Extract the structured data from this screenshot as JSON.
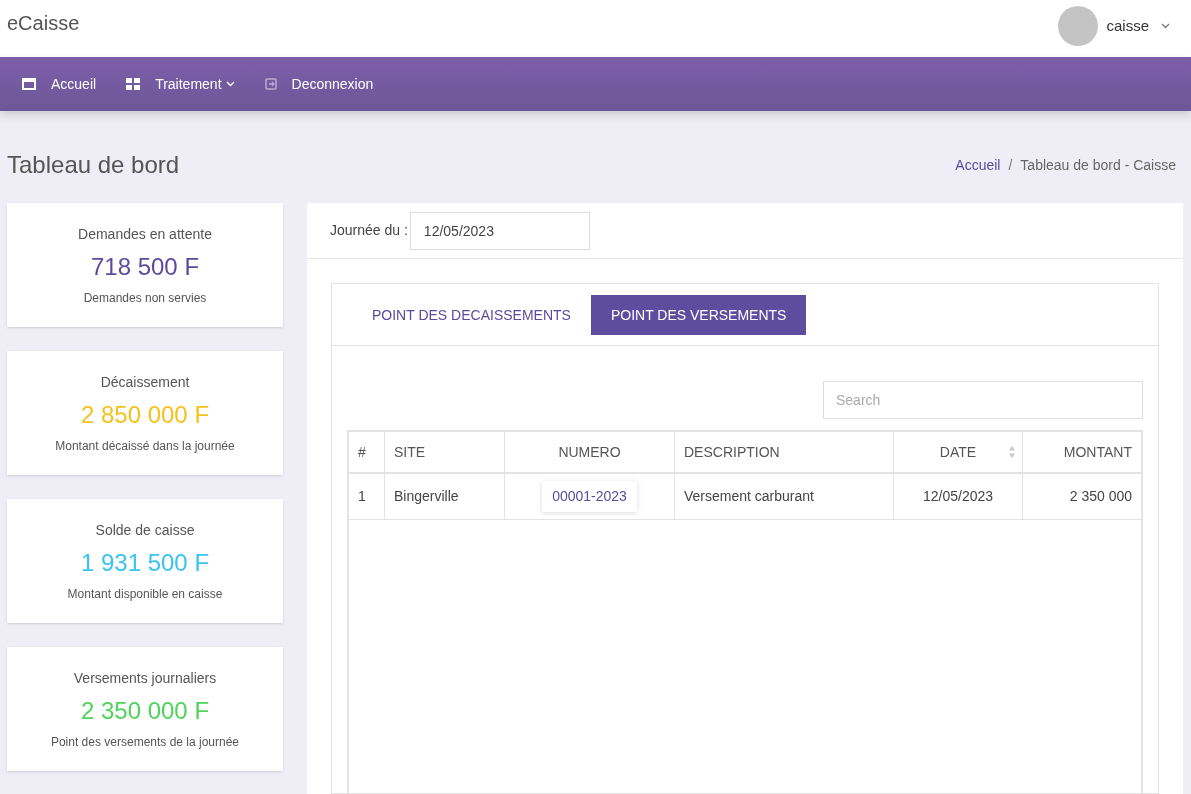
{
  "app_title": "eCaisse",
  "user": {
    "name": "caisse"
  },
  "nav": [
    {
      "label": "Accueil",
      "kind": "window"
    },
    {
      "label": "Traitement",
      "kind": "grid",
      "dropdown": true
    },
    {
      "label": "Deconnexion",
      "kind": "exit",
      "dropdown": false
    }
  ],
  "page_title": "Tableau de bord",
  "breadcrumb": [
    {
      "label": "Accueil",
      "kind": "link"
    },
    {
      "label": "/",
      "kind": "separator"
    },
    {
      "label": "Tableau de bord - Caisse",
      "kind": "current"
    }
  ],
  "stats": [
    {
      "title": "Demandes en attente",
      "value": "718 500 F",
      "caption": "Demandes non servies",
      "color": "#5b4a9e"
    },
    {
      "title": "Décaissement",
      "value": "2 850 000 F",
      "caption": "Montant décaissé dans la journée",
      "color": "#f5c21b"
    },
    {
      "title": "Solde de caisse",
      "value": "1 931 500 F",
      "caption": "Montant disponible en caisse",
      "color": "#38c3f0"
    },
    {
      "title": "Versements journaliers",
      "value": "2 350 000 F",
      "caption": "Point des versements de la journée",
      "color": "#4fd35a"
    }
  ],
  "date_filter": {
    "label": "Journée du :",
    "value": "12/05/2023"
  },
  "tabs": [
    {
      "label": "POINT DES DECAISSEMENTS",
      "selected": false
    },
    {
      "label": "POINT DES VERSEMENTS",
      "selected": true
    }
  ],
  "search": {
    "placeholder": "Search"
  },
  "table": {
    "columns": [
      {
        "label": "#",
        "sortable": false
      },
      {
        "label": "SITE",
        "sortable": false
      },
      {
        "label": "NUMERO",
        "sortable": false
      },
      {
        "label": "DESCRIPTION",
        "sortable": false
      },
      {
        "label": "DATE",
        "sortable": true
      },
      {
        "label": "MONTANT",
        "sortable": false
      }
    ],
    "rows": [
      [
        "1",
        "Bingerville",
        "00001-2023",
        "Versement carburant",
        "12/05/2023",
        "2 350 000"
      ]
    ]
  }
}
